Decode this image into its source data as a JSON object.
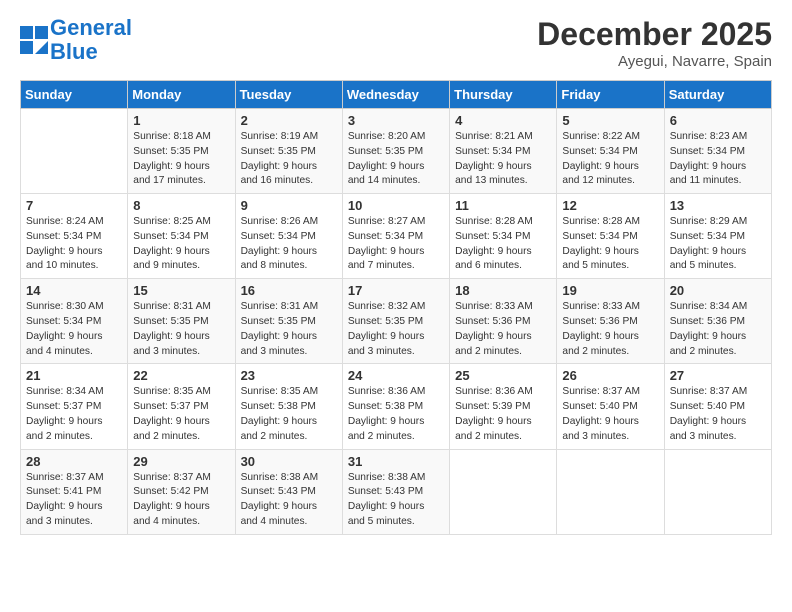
{
  "header": {
    "logo_line1": "General",
    "logo_line2": "Blue",
    "month_title": "December 2025",
    "location": "Ayegui, Navarre, Spain"
  },
  "days_of_week": [
    "Sunday",
    "Monday",
    "Tuesday",
    "Wednesday",
    "Thursday",
    "Friday",
    "Saturday"
  ],
  "weeks": [
    [
      {
        "day": "",
        "content": ""
      },
      {
        "day": "1",
        "content": "Sunrise: 8:18 AM\nSunset: 5:35 PM\nDaylight: 9 hours\nand 17 minutes."
      },
      {
        "day": "2",
        "content": "Sunrise: 8:19 AM\nSunset: 5:35 PM\nDaylight: 9 hours\nand 16 minutes."
      },
      {
        "day": "3",
        "content": "Sunrise: 8:20 AM\nSunset: 5:35 PM\nDaylight: 9 hours\nand 14 minutes."
      },
      {
        "day": "4",
        "content": "Sunrise: 8:21 AM\nSunset: 5:34 PM\nDaylight: 9 hours\nand 13 minutes."
      },
      {
        "day": "5",
        "content": "Sunrise: 8:22 AM\nSunset: 5:34 PM\nDaylight: 9 hours\nand 12 minutes."
      },
      {
        "day": "6",
        "content": "Sunrise: 8:23 AM\nSunset: 5:34 PM\nDaylight: 9 hours\nand 11 minutes."
      }
    ],
    [
      {
        "day": "7",
        "content": "Sunrise: 8:24 AM\nSunset: 5:34 PM\nDaylight: 9 hours\nand 10 minutes."
      },
      {
        "day": "8",
        "content": "Sunrise: 8:25 AM\nSunset: 5:34 PM\nDaylight: 9 hours\nand 9 minutes."
      },
      {
        "day": "9",
        "content": "Sunrise: 8:26 AM\nSunset: 5:34 PM\nDaylight: 9 hours\nand 8 minutes."
      },
      {
        "day": "10",
        "content": "Sunrise: 8:27 AM\nSunset: 5:34 PM\nDaylight: 9 hours\nand 7 minutes."
      },
      {
        "day": "11",
        "content": "Sunrise: 8:28 AM\nSunset: 5:34 PM\nDaylight: 9 hours\nand 6 minutes."
      },
      {
        "day": "12",
        "content": "Sunrise: 8:28 AM\nSunset: 5:34 PM\nDaylight: 9 hours\nand 5 minutes."
      },
      {
        "day": "13",
        "content": "Sunrise: 8:29 AM\nSunset: 5:34 PM\nDaylight: 9 hours\nand 5 minutes."
      }
    ],
    [
      {
        "day": "14",
        "content": "Sunrise: 8:30 AM\nSunset: 5:34 PM\nDaylight: 9 hours\nand 4 minutes."
      },
      {
        "day": "15",
        "content": "Sunrise: 8:31 AM\nSunset: 5:35 PM\nDaylight: 9 hours\nand 3 minutes."
      },
      {
        "day": "16",
        "content": "Sunrise: 8:31 AM\nSunset: 5:35 PM\nDaylight: 9 hours\nand 3 minutes."
      },
      {
        "day": "17",
        "content": "Sunrise: 8:32 AM\nSunset: 5:35 PM\nDaylight: 9 hours\nand 3 minutes."
      },
      {
        "day": "18",
        "content": "Sunrise: 8:33 AM\nSunset: 5:36 PM\nDaylight: 9 hours\nand 2 minutes."
      },
      {
        "day": "19",
        "content": "Sunrise: 8:33 AM\nSunset: 5:36 PM\nDaylight: 9 hours\nand 2 minutes."
      },
      {
        "day": "20",
        "content": "Sunrise: 8:34 AM\nSunset: 5:36 PM\nDaylight: 9 hours\nand 2 minutes."
      }
    ],
    [
      {
        "day": "21",
        "content": "Sunrise: 8:34 AM\nSunset: 5:37 PM\nDaylight: 9 hours\nand 2 minutes."
      },
      {
        "day": "22",
        "content": "Sunrise: 8:35 AM\nSunset: 5:37 PM\nDaylight: 9 hours\nand 2 minutes."
      },
      {
        "day": "23",
        "content": "Sunrise: 8:35 AM\nSunset: 5:38 PM\nDaylight: 9 hours\nand 2 minutes."
      },
      {
        "day": "24",
        "content": "Sunrise: 8:36 AM\nSunset: 5:38 PM\nDaylight: 9 hours\nand 2 minutes."
      },
      {
        "day": "25",
        "content": "Sunrise: 8:36 AM\nSunset: 5:39 PM\nDaylight: 9 hours\nand 2 minutes."
      },
      {
        "day": "26",
        "content": "Sunrise: 8:37 AM\nSunset: 5:40 PM\nDaylight: 9 hours\nand 3 minutes."
      },
      {
        "day": "27",
        "content": "Sunrise: 8:37 AM\nSunset: 5:40 PM\nDaylight: 9 hours\nand 3 minutes."
      }
    ],
    [
      {
        "day": "28",
        "content": "Sunrise: 8:37 AM\nSunset: 5:41 PM\nDaylight: 9 hours\nand 3 minutes."
      },
      {
        "day": "29",
        "content": "Sunrise: 8:37 AM\nSunset: 5:42 PM\nDaylight: 9 hours\nand 4 minutes."
      },
      {
        "day": "30",
        "content": "Sunrise: 8:38 AM\nSunset: 5:43 PM\nDaylight: 9 hours\nand 4 minutes."
      },
      {
        "day": "31",
        "content": "Sunrise: 8:38 AM\nSunset: 5:43 PM\nDaylight: 9 hours\nand 5 minutes."
      },
      {
        "day": "",
        "content": ""
      },
      {
        "day": "",
        "content": ""
      },
      {
        "day": "",
        "content": ""
      }
    ]
  ]
}
